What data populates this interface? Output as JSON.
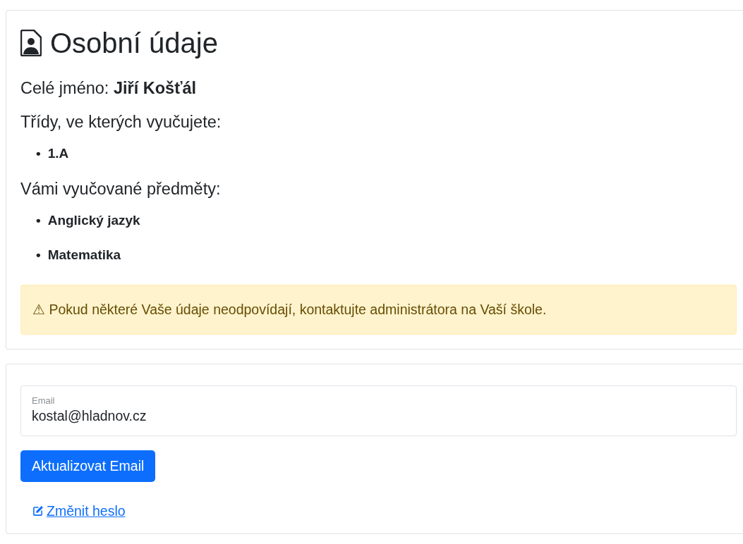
{
  "profile": {
    "title": "Osobní údaje",
    "full_name_label": "Celé jméno:",
    "full_name": "Jiří Košťál",
    "classes_heading": "Třídy, ve kterých vyučujete:",
    "classes": [
      {
        "marker": "•",
        "label": "1.A"
      }
    ],
    "subjects_heading": "Vámi vyučované předměty:",
    "subjects": [
      {
        "marker": "•",
        "label": "Anglický jazyk"
      },
      {
        "marker": "•",
        "label": "Matematika"
      }
    ],
    "alert": "⚠ Pokud některé Vaše údaje neodpovídají, kontaktujte administrátora na Vaší škole."
  },
  "account": {
    "email_field": {
      "label": "Email",
      "value": "kostal@hladnov.cz"
    },
    "update_button": "Aktualizovat Email",
    "password_link": "Změnit heslo"
  }
}
